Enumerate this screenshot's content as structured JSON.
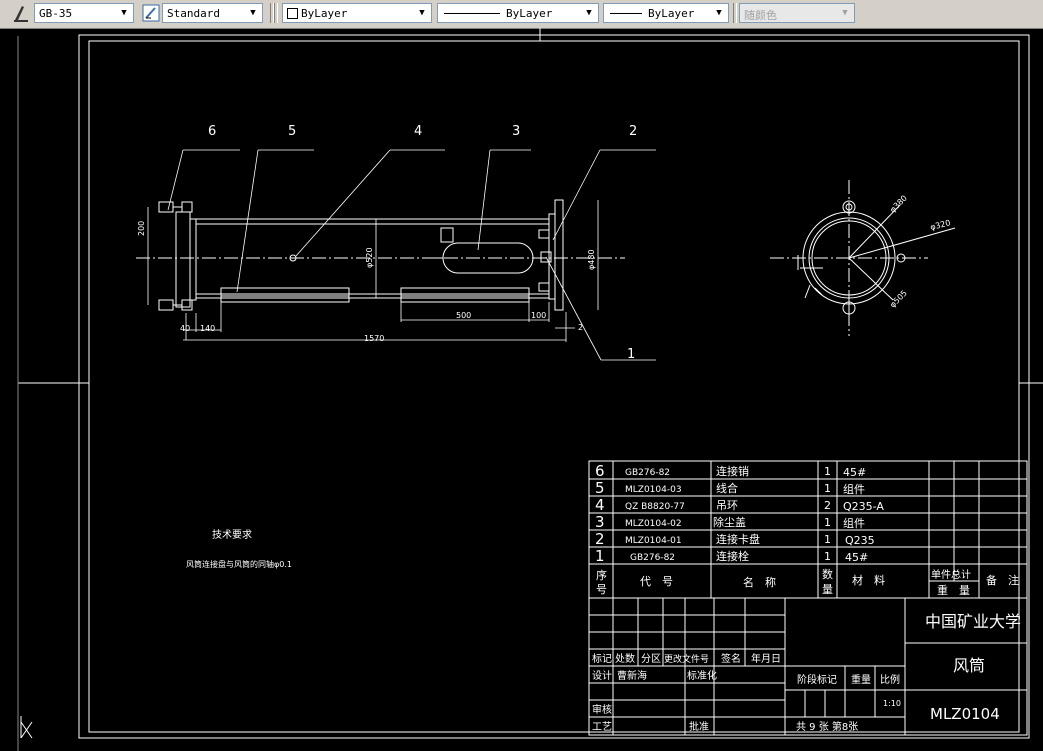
{
  "toolbar": {
    "text_style": "GB-35",
    "dim_style": "Standard",
    "layer": "ByLayer",
    "linetype": "ByLayer",
    "lineweight": "ByLayer",
    "color": "随颜色"
  },
  "drawing": {
    "balloons": [
      "6",
      "5",
      "4",
      "3",
      "2",
      "1"
    ],
    "dims": {
      "d200": "200",
      "d520": "φ520",
      "d480": "φ480",
      "d40": "40",
      "d140": "140",
      "d1570": "1570",
      "d500": "500",
      "d100": "100",
      "d2": "2",
      "d380": "φ380",
      "d320": "φ320",
      "d505": "φ505"
    },
    "tech_req_title": "技术要求",
    "tech_req_text": "风筒连接盘与风筒的同轴φ0.1"
  },
  "parts_list": {
    "rows": [
      {
        "no": "6",
        "code": "GB276-82",
        "name": "连接销",
        "qty": "1",
        "material": "45#"
      },
      {
        "no": "5",
        "code": "MLZ0104-03",
        "name": "线合",
        "qty": "1",
        "material": "组件"
      },
      {
        "no": "4",
        "code": "QZ B8820-77",
        "name": "吊环",
        "qty": "2",
        "material": "Q235-A"
      },
      {
        "no": "3",
        "code": "MLZ0104-02",
        "name": "除尘盖",
        "qty": "1",
        "material": "组件"
      },
      {
        "no": "2",
        "code": "MLZ0104-01",
        "name": "连接卡盘",
        "qty": "1",
        "material": "Q235"
      },
      {
        "no": "1",
        "code": "GB276-82",
        "name": "连接栓",
        "qty": "1",
        "material": "45#"
      }
    ],
    "header": {
      "no": "序号",
      "no_a": "序",
      "no_b": "号",
      "code": "代　号",
      "name": "名　称",
      "qty_a": "数",
      "qty_b": "量",
      "material": "材　料",
      "unit_total": "单件总计",
      "weight": "重　量",
      "remark": "备　注"
    }
  },
  "title_block": {
    "org": "中国矿业大学",
    "title": "风筒",
    "drawing_no": "MLZ0104",
    "mark": "标记",
    "count": "处数",
    "zone": "分区",
    "change_doc": "更改文件号",
    "sign": "签名",
    "date": "年月日",
    "design": "设计",
    "designer": "曹新海",
    "standard": "标准化",
    "stage": "阶段标记",
    "weight": "重量",
    "scale": "比例",
    "scale_value": "1:10",
    "review": "审核",
    "process": "工艺",
    "approve": "批准",
    "sheets": "共 9 张  第8张"
  },
  "colors": {
    "background": "#000000",
    "lines": "#ffffff",
    "toolbar": "#d4d0c8"
  }
}
